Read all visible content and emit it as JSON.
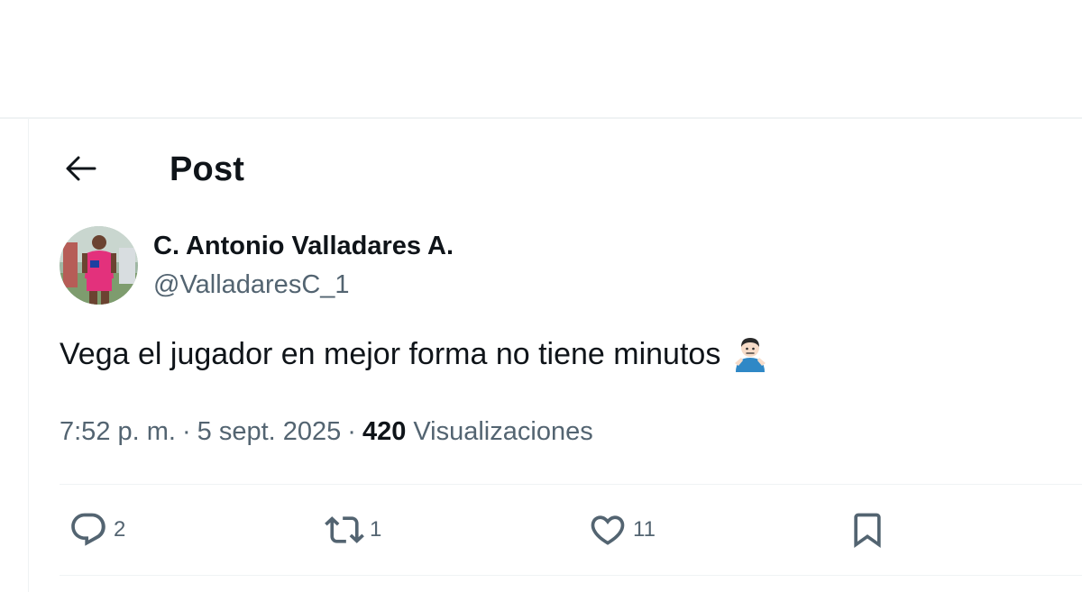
{
  "header": {
    "title": "Post",
    "back_icon": "arrow-left-icon"
  },
  "post": {
    "author": {
      "display_name": "C. Antonio Valladares A.",
      "handle": "@ValladaresC_1",
      "avatar_icon": "profile-photo"
    },
    "text": "Vega el jugador en mejor forma no tiene minutos",
    "emoji": "man-shrugging",
    "meta": {
      "time": "7:52 p. m.",
      "separator": "·",
      "date": "5 sept. 2025",
      "views_count": "420",
      "views_label": "Visualizaciones"
    },
    "actions": {
      "replies": "2",
      "reposts": "1",
      "likes": "11"
    }
  },
  "colors": {
    "text_primary": "#0f1419",
    "text_secondary": "#536471",
    "divider": "#eff3f4"
  }
}
